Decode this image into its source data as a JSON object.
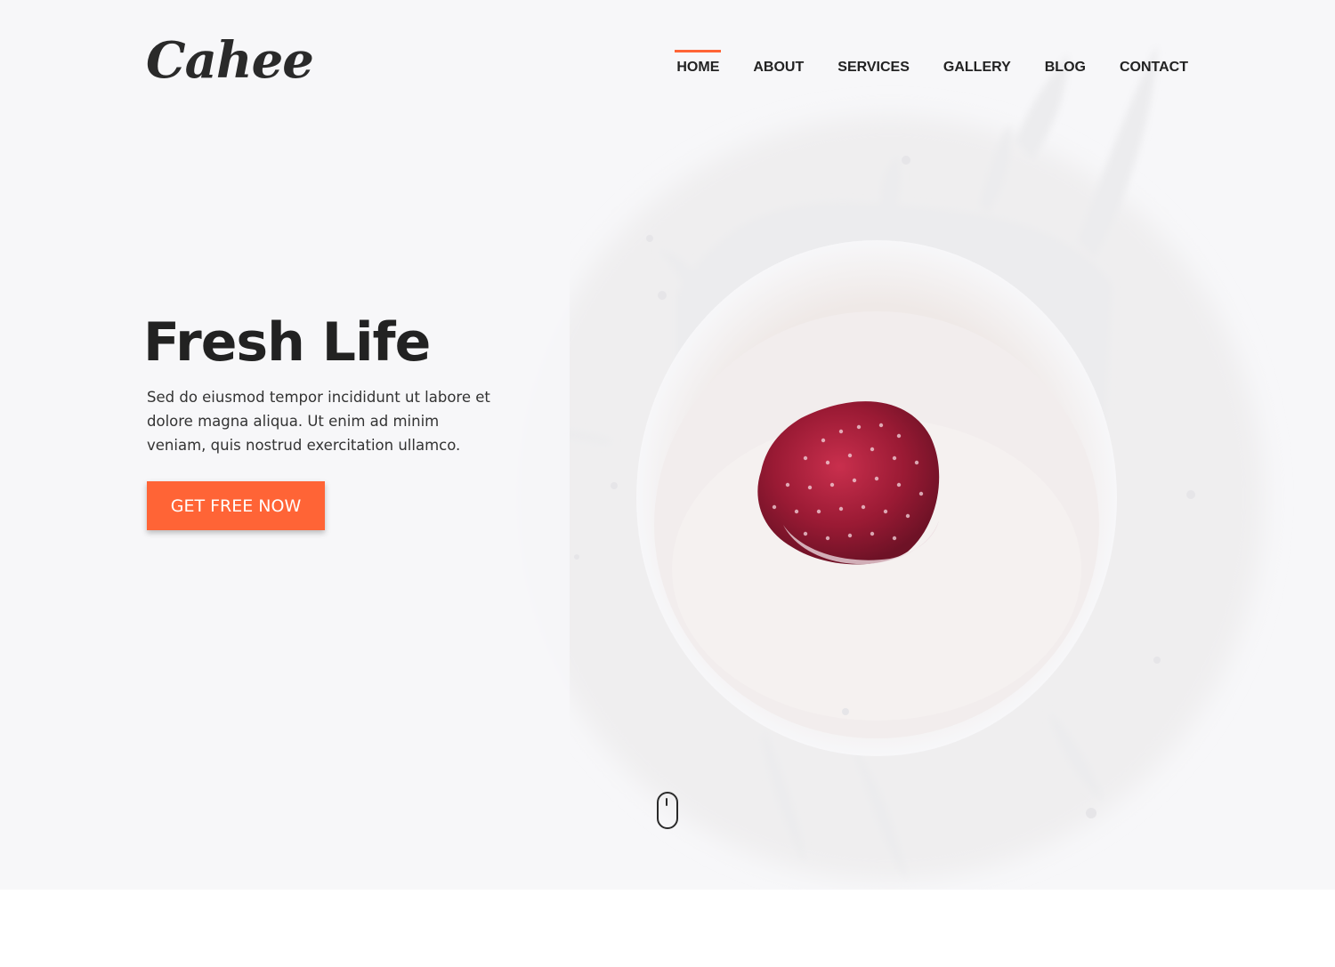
{
  "brand": {
    "logo_text": "Cahee"
  },
  "nav": {
    "items": [
      {
        "label": "HOME",
        "active": true
      },
      {
        "label": "ABOUT",
        "active": false
      },
      {
        "label": "SERVICES",
        "active": false
      },
      {
        "label": "GALLERY",
        "active": false
      },
      {
        "label": "BLOG",
        "active": false
      },
      {
        "label": "CONTACT",
        "active": false
      }
    ]
  },
  "hero": {
    "title": "Fresh Life",
    "description": "Sed do eiusmod tempor incididunt ut labore et dolore magna aliqua. Ut enim ad minim veniam, quis nostrud exercitation ullamco.",
    "cta_label": "GET FREE NOW",
    "image": "strawberry-milk-splash",
    "scroll_icon": "mouse-scroll-icon"
  },
  "colors": {
    "accent": "#ff6436",
    "text": "#222222",
    "hero_bg": "#f7f7f9",
    "strawberry": "#b8203e"
  }
}
